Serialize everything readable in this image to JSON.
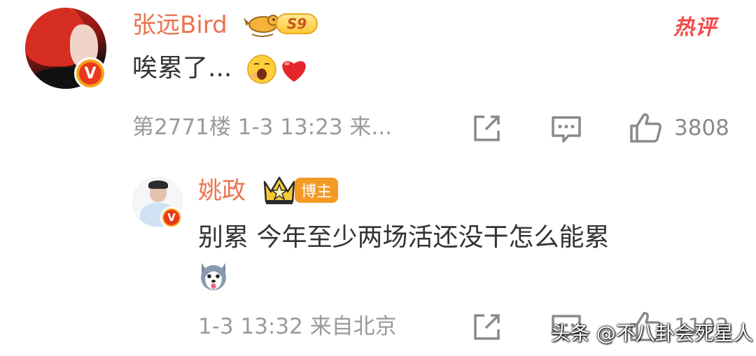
{
  "comment": {
    "username": "张远Bird",
    "level_badge": "S9",
    "hot_tag": "热评",
    "text": "唉累了...",
    "emojis": [
      "yawn-emoji",
      "heart-emoji"
    ],
    "meta": "第2771楼 1-3 13:23 来...",
    "likes": "3808"
  },
  "reply": {
    "username": "姚政",
    "tag": "博主",
    "text": "别累 今年至少两场活还没干怎么能累",
    "emoji": "husky-emoji",
    "meta": "1-3 13:32 来自北京",
    "likes": "1102"
  },
  "watermark": "头条 @不八卦会死星人",
  "colors": {
    "username": "#eb7350",
    "text": "#333333",
    "meta": "#9a9a9a",
    "hot": "#f14a4a",
    "blogger_tag": "#f39a24"
  }
}
